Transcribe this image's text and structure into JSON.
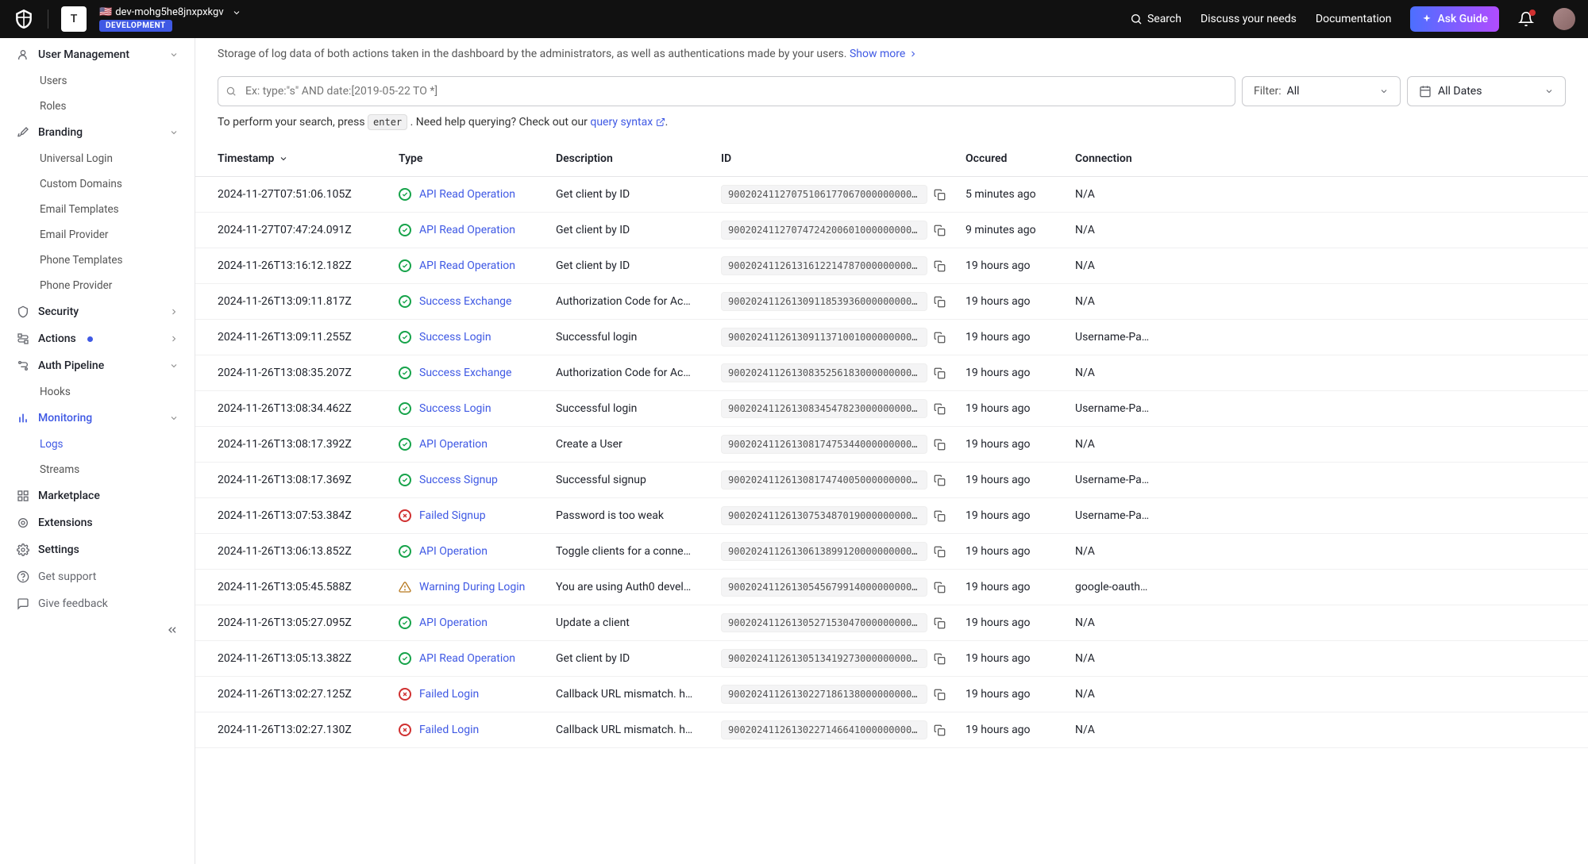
{
  "topbar": {
    "tenant_initial": "T",
    "tenant_name": "dev-mohg5he8jnxpxkgv",
    "env_tag": "DEVELOPMENT",
    "search": "Search",
    "discuss": "Discuss your needs",
    "documentation": "Documentation",
    "ask_guide": "Ask Guide"
  },
  "sidebar": {
    "user_mgmt": "User Management",
    "users": "Users",
    "roles": "Roles",
    "branding": "Branding",
    "universal_login": "Universal Login",
    "custom_domains": "Custom Domains",
    "email_templates": "Email Templates",
    "email_provider": "Email Provider",
    "phone_templates": "Phone Templates",
    "phone_provider": "Phone Provider",
    "security": "Security",
    "actions": "Actions",
    "auth_pipeline": "Auth Pipeline",
    "hooks": "Hooks",
    "monitoring": "Monitoring",
    "logs": "Logs",
    "streams": "Streams",
    "marketplace": "Marketplace",
    "extensions": "Extensions",
    "settings": "Settings",
    "get_support": "Get support",
    "give_feedback": "Give feedback"
  },
  "intro": {
    "text": "Storage of log data of both actions taken in the dashboard by the administrators, as well as authentications made by your users. ",
    "show_more": "Show more"
  },
  "search": {
    "placeholder": "Ex: type:\"s\" AND date:[2019-05-22 TO *]"
  },
  "filter": {
    "label": "Filter:",
    "value": "All"
  },
  "dates": {
    "value": "All Dates"
  },
  "help": {
    "prefix": "To perform your search, press ",
    "key": "enter",
    "mid": ". Need help querying? Check out our ",
    "link": "query syntax",
    "suffix": "."
  },
  "columns": {
    "timestamp": "Timestamp",
    "type": "Type",
    "description": "Description",
    "id": "ID",
    "occurred": "Occured",
    "connection": "Connection"
  },
  "rows": [
    {
      "ts": "2024-11-27T07:51:06.105Z",
      "status": "success",
      "type": "API Read Operation",
      "desc": "Get client by ID",
      "id": "900202411270751061770670000000000000…",
      "occ": "5 minutes ago",
      "conn": "N/A"
    },
    {
      "ts": "2024-11-27T07:47:24.091Z",
      "status": "success",
      "type": "API Read Operation",
      "desc": "Get client by ID",
      "id": "900202411270747242006010000000000000…",
      "occ": "9 minutes ago",
      "conn": "N/A"
    },
    {
      "ts": "2024-11-26T13:16:12.182Z",
      "status": "success",
      "type": "API Read Operation",
      "desc": "Get client by ID",
      "id": "900202411261316122147870000000000000…",
      "occ": "19 hours ago",
      "conn": "N/A"
    },
    {
      "ts": "2024-11-26T13:09:11.817Z",
      "status": "success",
      "type": "Success Exchange",
      "desc": "Authorization Code for Ac…",
      "id": "900202411261309118539360000000000000…",
      "occ": "19 hours ago",
      "conn": "N/A"
    },
    {
      "ts": "2024-11-26T13:09:11.255Z",
      "status": "success",
      "type": "Success Login",
      "desc": "Successful login",
      "id": "900202411261309113710010000000000000…",
      "occ": "19 hours ago",
      "conn": "Username-Pa…"
    },
    {
      "ts": "2024-11-26T13:08:35.207Z",
      "status": "success",
      "type": "Success Exchange",
      "desc": "Authorization Code for Ac…",
      "id": "900202411261308352561830000000000000…",
      "occ": "19 hours ago",
      "conn": "N/A"
    },
    {
      "ts": "2024-11-26T13:08:34.462Z",
      "status": "success",
      "type": "Success Login",
      "desc": "Successful login",
      "id": "900202411261308345478230000000000000…",
      "occ": "19 hours ago",
      "conn": "Username-Pa…"
    },
    {
      "ts": "2024-11-26T13:08:17.392Z",
      "status": "success",
      "type": "API Operation",
      "desc": "Create a User",
      "id": "900202411261308174753440000000000000…",
      "occ": "19 hours ago",
      "conn": "N/A"
    },
    {
      "ts": "2024-11-26T13:08:17.369Z",
      "status": "success",
      "type": "Success Signup",
      "desc": "Successful signup",
      "id": "900202411261308174740050000000000000…",
      "occ": "19 hours ago",
      "conn": "Username-Pa…"
    },
    {
      "ts": "2024-11-26T13:07:53.384Z",
      "status": "error",
      "type": "Failed Signup",
      "desc": "Password is too weak",
      "id": "900202411261307534870190000000000000…",
      "occ": "19 hours ago",
      "conn": "Username-Pa…"
    },
    {
      "ts": "2024-11-26T13:06:13.852Z",
      "status": "success",
      "type": "API Operation",
      "desc": "Toggle clients for a conne…",
      "id": "900202411261306138991200000000000000…",
      "occ": "19 hours ago",
      "conn": "N/A"
    },
    {
      "ts": "2024-11-26T13:05:45.588Z",
      "status": "warn",
      "type": "Warning During Login",
      "desc": "You are using Auth0 devel…",
      "id": "900202411261305456799140000000000000…",
      "occ": "19 hours ago",
      "conn": "google-oauth…"
    },
    {
      "ts": "2024-11-26T13:05:27.095Z",
      "status": "success",
      "type": "API Operation",
      "desc": "Update a client",
      "id": "900202411261305271530470000000000000…",
      "occ": "19 hours ago",
      "conn": "N/A"
    },
    {
      "ts": "2024-11-26T13:05:13.382Z",
      "status": "success",
      "type": "API Read Operation",
      "desc": "Get client by ID",
      "id": "900202411261305134192730000000000000…",
      "occ": "19 hours ago",
      "conn": "N/A"
    },
    {
      "ts": "2024-11-26T13:02:27.125Z",
      "status": "error",
      "type": "Failed Login",
      "desc": "Callback URL mismatch. h…",
      "id": "900202411261302271861380000000000000…",
      "occ": "19 hours ago",
      "conn": "N/A"
    },
    {
      "ts": "2024-11-26T13:02:27.130Z",
      "status": "error",
      "type": "Failed Login",
      "desc": "Callback URL mismatch. h…",
      "id": "900202411261302271466410000000000000…",
      "occ": "19 hours ago",
      "conn": "N/A"
    }
  ]
}
